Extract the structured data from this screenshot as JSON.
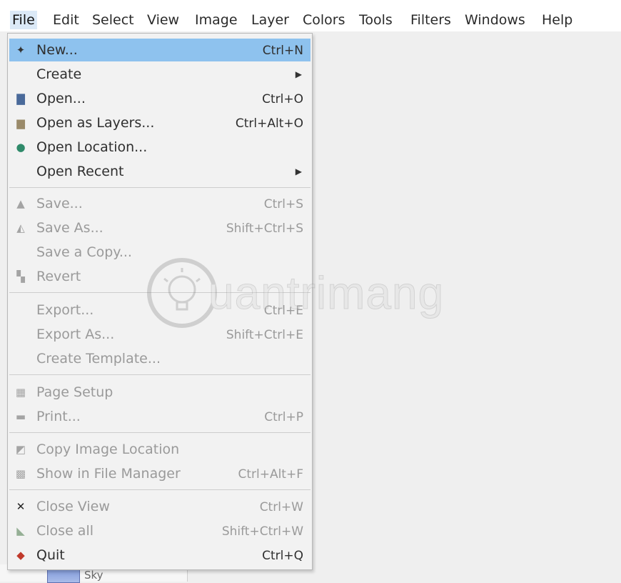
{
  "menubar": {
    "items": [
      "File",
      "Edit",
      "Select",
      "View",
      "Image",
      "Layer",
      "Colors",
      "Tools",
      "Filters",
      "Windows",
      "Help"
    ],
    "active": "File"
  },
  "file_menu": {
    "items": [
      {
        "label": "New...",
        "shortcut": "Ctrl+N",
        "icon": "new-image-icon",
        "enabled": true,
        "highlighted": true
      },
      {
        "label": "Create",
        "submenu": true,
        "enabled": true
      },
      {
        "label": "Open...",
        "shortcut": "Ctrl+O",
        "icon": "open-icon",
        "enabled": true
      },
      {
        "label": "Open as Layers...",
        "shortcut": "Ctrl+Alt+O",
        "icon": "open-as-layers-icon",
        "enabled": true
      },
      {
        "label": "Open Location...",
        "icon": "globe-icon",
        "enabled": true
      },
      {
        "label": "Open Recent",
        "submenu": true,
        "enabled": true
      },
      {
        "label": "Save...",
        "shortcut": "Ctrl+S",
        "icon": "save-icon",
        "enabled": false
      },
      {
        "label": "Save As...",
        "shortcut": "Shift+Ctrl+S",
        "icon": "save-as-icon",
        "enabled": false
      },
      {
        "label": "Save a Copy...",
        "enabled": false
      },
      {
        "label": "Revert",
        "icon": "revert-icon",
        "enabled": false
      },
      {
        "label": "Export...",
        "shortcut": "Ctrl+E",
        "enabled": false
      },
      {
        "label": "Export As...",
        "shortcut": "Shift+Ctrl+E",
        "enabled": false
      },
      {
        "label": "Create Template...",
        "enabled": false
      },
      {
        "label": "Page Setup",
        "icon": "page-setup-icon",
        "enabled": false
      },
      {
        "label": "Print...",
        "shortcut": "Ctrl+P",
        "icon": "printer-icon",
        "enabled": false
      },
      {
        "label": "Copy Image Location",
        "icon": "copy-location-icon",
        "enabled": false
      },
      {
        "label": "Show in File Manager",
        "shortcut": "Ctrl+Alt+F",
        "icon": "file-manager-icon",
        "enabled": false
      },
      {
        "label": "Close View",
        "shortcut": "Ctrl+W",
        "icon": "close-icon",
        "enabled": false
      },
      {
        "label": "Close all",
        "shortcut": "Shift+Ctrl+W",
        "icon": "close-all-icon",
        "enabled": false
      },
      {
        "label": "Quit",
        "shortcut": "Ctrl+Q",
        "icon": "quit-icon",
        "enabled": true
      }
    ]
  },
  "layers_panel": {
    "layer_name": "Sky"
  },
  "watermark": {
    "text": "uantrimang"
  }
}
